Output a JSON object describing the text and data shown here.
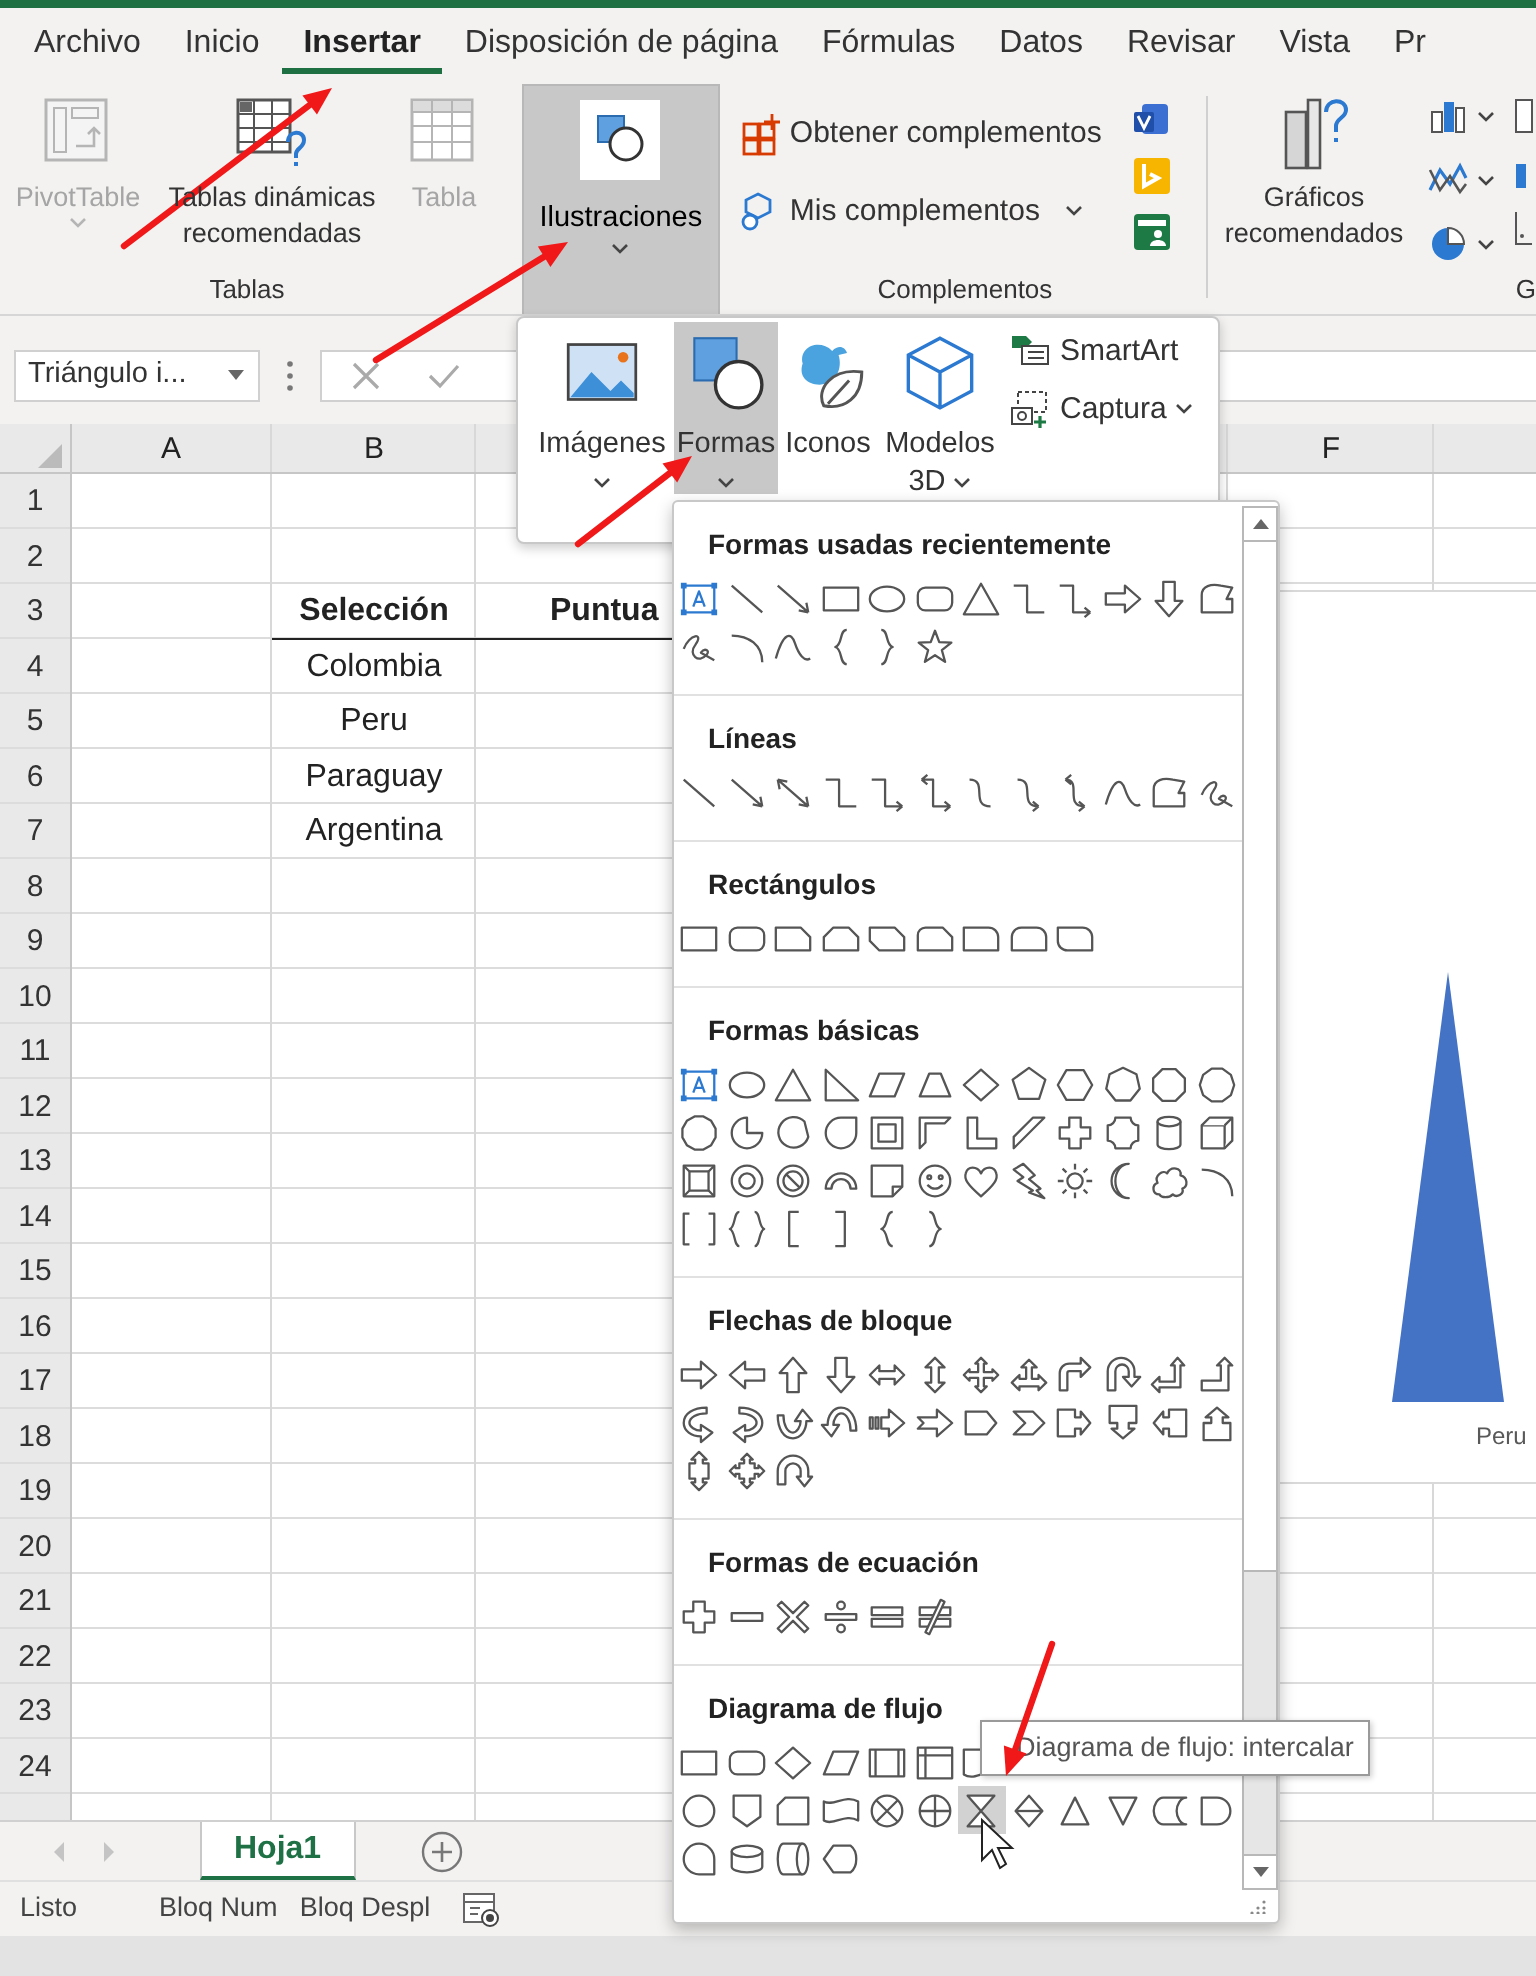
{
  "tabs": [
    {
      "label": "Archivo",
      "selected": false
    },
    {
      "label": "Inicio",
      "selected": false
    },
    {
      "label": "Insertar",
      "selected": true
    },
    {
      "label": "Disposición de página",
      "selected": false
    },
    {
      "label": "Fórmulas",
      "selected": false
    },
    {
      "label": "Datos",
      "selected": false
    },
    {
      "label": "Revisar",
      "selected": false
    },
    {
      "label": "Vista",
      "selected": false
    },
    {
      "label": "Pr",
      "selected": false
    }
  ],
  "ribbon": {
    "tables_group": {
      "label": "Tablas",
      "buttons": [
        {
          "label": "PivotTable",
          "disabled": true,
          "dropdown": true
        },
        {
          "label": "Tablas dinámicas recomendadas",
          "disabled": false,
          "dropdown": false
        },
        {
          "label": "Tabla",
          "disabled": true,
          "dropdown": false
        }
      ]
    },
    "illustrations_button": {
      "label": "Ilustraciones",
      "pressed": true
    },
    "addins_group": {
      "label": "Complementos",
      "buttons": [
        {
          "label": "Obtener complementos",
          "dropdown": false
        },
        {
          "label": "Mis complementos",
          "dropdown": true
        }
      ]
    },
    "charts_group": {
      "label": "G",
      "button": "Gráficos recomendados"
    }
  },
  "formula_bar": {
    "name_box": "Triángulo i..."
  },
  "column_headers": [
    "A",
    "B",
    "F"
  ],
  "row_headers": [
    "1",
    "2",
    "3",
    "4",
    "5",
    "6",
    "7",
    "8",
    "9",
    "10",
    "11",
    "12",
    "13",
    "14",
    "15",
    "16",
    "17",
    "18",
    "19",
    "20",
    "21",
    "22",
    "23",
    "24"
  ],
  "table": {
    "header": [
      "Selección",
      "Puntua"
    ],
    "rows": [
      [
        "Colombia"
      ],
      [
        "Peru"
      ],
      [
        "Paraguay"
      ],
      [
        "Argentina"
      ]
    ]
  },
  "chart": {
    "category_label": "Peru"
  },
  "illustrations_menu": {
    "items": [
      {
        "label": "Imágenes",
        "dropdown": true,
        "selected": false
      },
      {
        "label": "Formas",
        "dropdown": true,
        "selected": true
      },
      {
        "label": "Iconos",
        "dropdown": false,
        "selected": false
      },
      {
        "label": "Modelos 3D",
        "dropdown": true,
        "selected": false
      }
    ],
    "small_items": [
      {
        "label": "SmartArt",
        "dropdown": false
      },
      {
        "label": "Captura",
        "dropdown": true
      }
    ]
  },
  "shape_gallery": {
    "sections": [
      {
        "title": "Formas usadas recientemente",
        "rows": [
          [
            {
              "hovered": false
            },
            {
              "hovered": false
            },
            {
              "hovered": false
            },
            {
              "hovered": false
            },
            {
              "hovered": false
            },
            {
              "hovered": false
            },
            {
              "hovered": false
            },
            {
              "hovered": false
            },
            {
              "hovered": false
            },
            {
              "hovered": false
            },
            {
              "hovered": false
            },
            {
              "hovered": false
            }
          ],
          [
            {
              "hovered": false
            },
            {
              "hovered": false
            },
            {
              "hovered": false
            },
            {
              "hovered": false
            },
            {
              "hovered": false
            },
            {
              "hovered": false
            }
          ]
        ]
      },
      {
        "title": "Líneas",
        "rows": [
          [
            {
              "hovered": false
            },
            {
              "hovered": false
            },
            {
              "hovered": false
            },
            {
              "hovered": false
            },
            {
              "hovered": false
            },
            {
              "hovered": false
            },
            {
              "hovered": false
            },
            {
              "hovered": false
            },
            {
              "hovered": false
            },
            {
              "hovered": false
            },
            {
              "hovered": false
            },
            {
              "hovered": false
            }
          ]
        ]
      },
      {
        "title": "Rectángulos",
        "rows": [
          [
            {
              "hovered": false
            },
            {
              "hovered": false
            },
            {
              "hovered": false
            },
            {
              "hovered": false
            },
            {
              "hovered": false
            },
            {
              "hovered": false
            },
            {
              "hovered": false
            },
            {
              "hovered": false
            },
            {
              "hovered": false
            }
          ]
        ]
      },
      {
        "title": "Formas básicas",
        "rows": [
          [
            {
              "hovered": false
            },
            {
              "hovered": false
            },
            {
              "hovered": false
            },
            {
              "hovered": false
            },
            {
              "hovered": false
            },
            {
              "hovered": false
            },
            {
              "hovered": false
            },
            {
              "hovered": false
            },
            {
              "hovered": false
            },
            {
              "hovered": false
            },
            {
              "hovered": false
            },
            {
              "hovered": false
            }
          ],
          [
            {
              "hovered": false
            },
            {
              "hovered": false
            },
            {
              "hovered": false
            },
            {
              "hovered": false
            },
            {
              "hovered": false
            },
            {
              "hovered": false
            },
            {
              "hovered": false
            },
            {
              "hovered": false
            },
            {
              "hovered": false
            },
            {
              "hovered": false
            },
            {
              "hovered": false
            },
            {
              "hovered": false
            }
          ],
          [
            {
              "hovered": false
            },
            {
              "hovered": false
            },
            {
              "hovered": false
            },
            {
              "hovered": false
            },
            {
              "hovered": false
            },
            {
              "hovered": false
            },
            {
              "hovered": false
            },
            {
              "hovered": false
            },
            {
              "hovered": false
            },
            {
              "hovered": false
            },
            {
              "hovered": false
            },
            {
              "hovered": false
            }
          ],
          [
            {
              "hovered": false
            },
            {
              "hovered": false
            },
            {
              "hovered": false
            },
            {
              "hovered": false
            },
            {
              "hovered": false
            },
            {
              "hovered": false
            }
          ]
        ]
      },
      {
        "title": "Flechas de bloque",
        "rows": [
          [
            {
              "hovered": false
            },
            {
              "hovered": false
            },
            {
              "hovered": false
            },
            {
              "hovered": false
            },
            {
              "hovered": false
            },
            {
              "hovered": false
            },
            {
              "hovered": false
            },
            {
              "hovered": false
            },
            {
              "hovered": false
            },
            {
              "hovered": false
            },
            {
              "hovered": false
            },
            {
              "hovered": false
            }
          ],
          [
            {
              "hovered": false
            },
            {
              "hovered": false
            },
            {
              "hovered": false
            },
            {
              "hovered": false
            },
            {
              "hovered": false
            },
            {
              "hovered": false
            },
            {
              "hovered": false
            },
            {
              "hovered": false
            },
            {
              "hovered": false
            },
            {
              "hovered": false
            },
            {
              "hovered": false
            },
            {
              "hovered": false
            }
          ],
          [
            {
              "hovered": false
            },
            {
              "hovered": false
            },
            {
              "hovered": false
            }
          ]
        ]
      },
      {
        "title": "Formas de ecuación",
        "rows": [
          [
            {
              "hovered": false
            },
            {
              "hovered": false
            },
            {
              "hovered": false
            },
            {
              "hovered": false
            },
            {
              "hovered": false
            },
            {
              "hovered": false
            }
          ]
        ]
      },
      {
        "title": "Diagrama de flujo",
        "rows": [
          [
            {
              "hovered": false
            },
            {
              "hovered": false
            },
            {
              "hovered": false
            },
            {
              "hovered": false
            },
            {
              "hovered": false
            },
            {
              "hovered": false
            },
            {
              "hovered": false
            }
          ],
          [
            {
              "hovered": false
            },
            {
              "hovered": false
            },
            {
              "hovered": false
            },
            {
              "hovered": false
            },
            {
              "hovered": false
            },
            {
              "hovered": false
            },
            {
              "hovered": true
            },
            {
              "hovered": false
            },
            {
              "hovered": false
            },
            {
              "hovered": false
            },
            {
              "hovered": false
            },
            {
              "hovered": false
            }
          ],
          [
            {
              "hovered": false
            },
            {
              "hovered": false
            },
            {
              "hovered": false
            },
            {
              "hovered": false
            }
          ]
        ]
      }
    ],
    "tooltip": "Diagrama de flujo: intercalar"
  },
  "sheet_tabs": [
    {
      "label": "Hoja1",
      "selected": true
    }
  ],
  "status_bar": [
    "Listo",
    "Bloq Num",
    "Bloq Despl"
  ]
}
